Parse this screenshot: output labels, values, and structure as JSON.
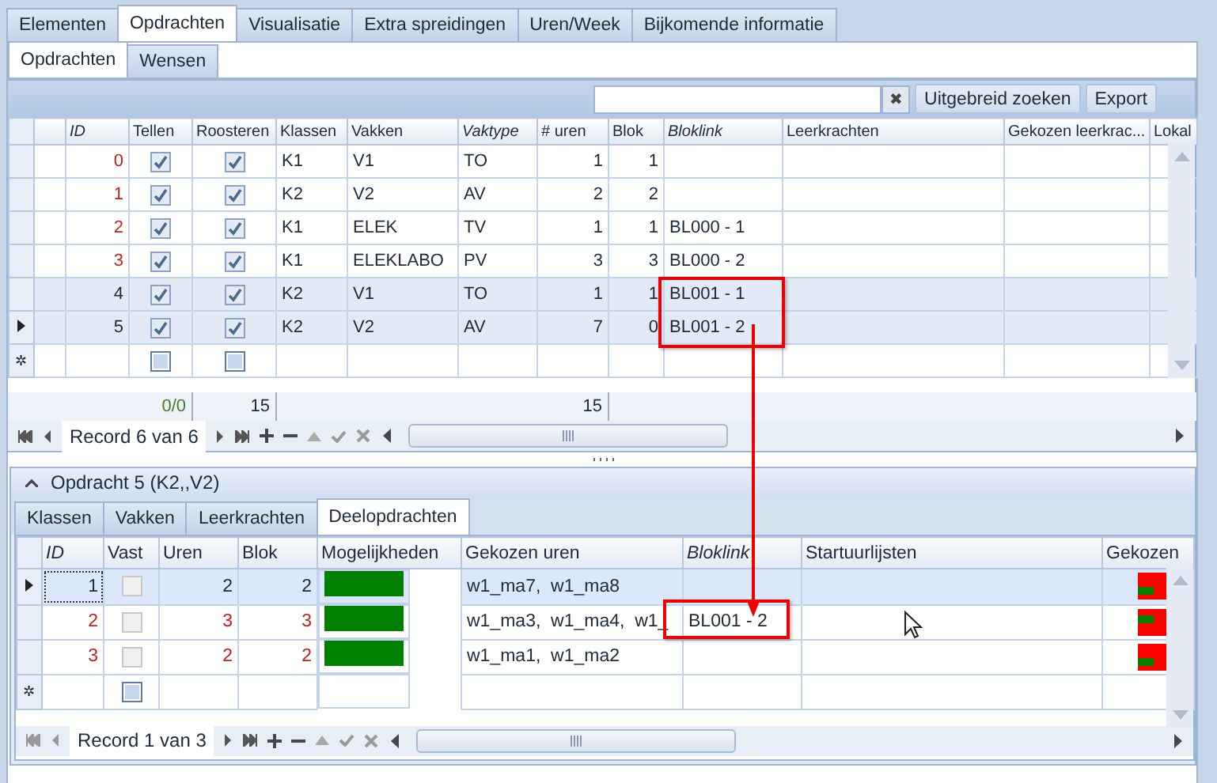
{
  "tabs": [
    {
      "label": "Elementen",
      "selected": false
    },
    {
      "label": "Opdrachten",
      "selected": true
    },
    {
      "label": "Visualisatie",
      "selected": false
    },
    {
      "label": "Extra spreidingen",
      "selected": false
    },
    {
      "label": "Uren/Week",
      "selected": false
    },
    {
      "label": "Bijkomende informatie",
      "selected": false
    }
  ],
  "subtabs": [
    {
      "label": "Opdrachten",
      "selected": true
    },
    {
      "label": "Wensen",
      "selected": false
    }
  ],
  "toolbar": {
    "search": {
      "clear": "✖"
    },
    "buttons": [
      "Uitgebreid zoeken",
      "Export"
    ]
  },
  "grid": {
    "columns": [
      {
        "label": "ID",
        "kind": "num",
        "italic": true
      },
      {
        "label": "Tellen",
        "kind": "check",
        "italic": false
      },
      {
        "label": "Roosteren",
        "kind": "check",
        "italic": false
      },
      {
        "label": "Klassen",
        "kind": "text",
        "italic": false
      },
      {
        "label": "Vakken",
        "kind": "text",
        "italic": false
      },
      {
        "label": "Vaktype",
        "kind": "text",
        "italic": true
      },
      {
        "label": "# uren",
        "kind": "num",
        "italic": false
      },
      {
        "label": "Blok",
        "kind": "num",
        "italic": false
      },
      {
        "label": "Bloklink",
        "kind": "text",
        "italic": true
      },
      {
        "label": "Leerkrachten",
        "kind": "text",
        "italic": false
      },
      {
        "label": "Gekozen leerkrac...",
        "kind": "text",
        "italic": false
      },
      {
        "label": "Lokal",
        "kind": "text",
        "italic": false
      }
    ],
    "rows": [
      {
        "cells": [
          "0",
          true,
          true,
          "K1",
          "V1",
          "TO",
          "1",
          "1"
        ],
        "linked": false,
        "current": false
      },
      {
        "cells": [
          "1",
          true,
          true,
          "K2",
          "V2",
          "AV",
          "2",
          "2"
        ],
        "linked": false,
        "current": false
      },
      {
        "cells": [
          "2",
          true,
          true,
          "K1",
          "ELEK",
          "TV",
          "1",
          "1",
          "BL000 - 1"
        ],
        "linked": false,
        "current": false
      },
      {
        "cells": [
          "3",
          true,
          true,
          "K1",
          "ELEKLABO",
          "PV",
          "3",
          "3",
          "BL000 - 2"
        ],
        "linked": false,
        "current": false
      },
      {
        "cells": [
          "4",
          true,
          true,
          "K2",
          "V1",
          "TO",
          "1",
          "1",
          "BL001 - 1"
        ],
        "linked": true,
        "current": false
      },
      {
        "cells": [
          "5",
          true,
          true,
          "K2",
          "V2",
          "AV",
          "7",
          "0",
          "BL001 - 2"
        ],
        "linked": true,
        "current": true
      }
    ],
    "new_row": {
      "marker": "✲",
      "cells": [
        null,
        false,
        false
      ]
    },
    "footer": [
      {
        "text": "0/0"
      },
      {
        "text": "15"
      },
      {
        "text": "15"
      }
    ],
    "navigator": "Record 6 van 6"
  },
  "detail": {
    "title": "Opdracht 5 (K2,,V2)",
    "tabs": [
      {
        "label": "Klassen",
        "selected": false
      },
      {
        "label": "Vakken",
        "selected": false
      },
      {
        "label": "Leerkrachten",
        "selected": false
      },
      {
        "label": "Deelopdrachten",
        "selected": true
      }
    ],
    "columns": [
      {
        "label": "ID",
        "kind": "num",
        "italic": true
      },
      {
        "label": "Vast",
        "kind": "check",
        "italic": false
      },
      {
        "label": "Uren",
        "kind": "num",
        "italic": false
      },
      {
        "label": "Blok",
        "kind": "num",
        "italic": false
      },
      {
        "label": "Mogelijkheden",
        "kind": "bar",
        "italic": false
      },
      {
        "label": "Gekozen uren",
        "kind": "text",
        "italic": false
      },
      {
        "label": "Bloklink",
        "kind": "text",
        "italic": true
      },
      {
        "label": "Startuurlijsten",
        "kind": "text",
        "italic": false
      },
      {
        "label": "Gekozen",
        "kind": "flag",
        "italic": false
      }
    ],
    "rows": [
      {
        "cells": [
          "1",
          false,
          "2",
          "2",
          null,
          "w1_ma7,  w1_ma8"
        ],
        "color": "#008000",
        "selected": true
      },
      {
        "cells": [
          "2",
          false,
          "3",
          "3",
          null,
          "w1_ma3,  w1_ma4,  w1_",
          "BL001 - 2"
        ],
        "color": "#008000",
        "selected": false
      },
      {
        "cells": [
          "3",
          false,
          "2",
          "2",
          null,
          "w1_ma1,  w1_ma2"
        ],
        "color": "#008000",
        "selected": false
      }
    ],
    "new_row": {
      "marker": "✲",
      "cells": [
        null,
        false
      ]
    },
    "navigator": "Record 1 van 3"
  }
}
